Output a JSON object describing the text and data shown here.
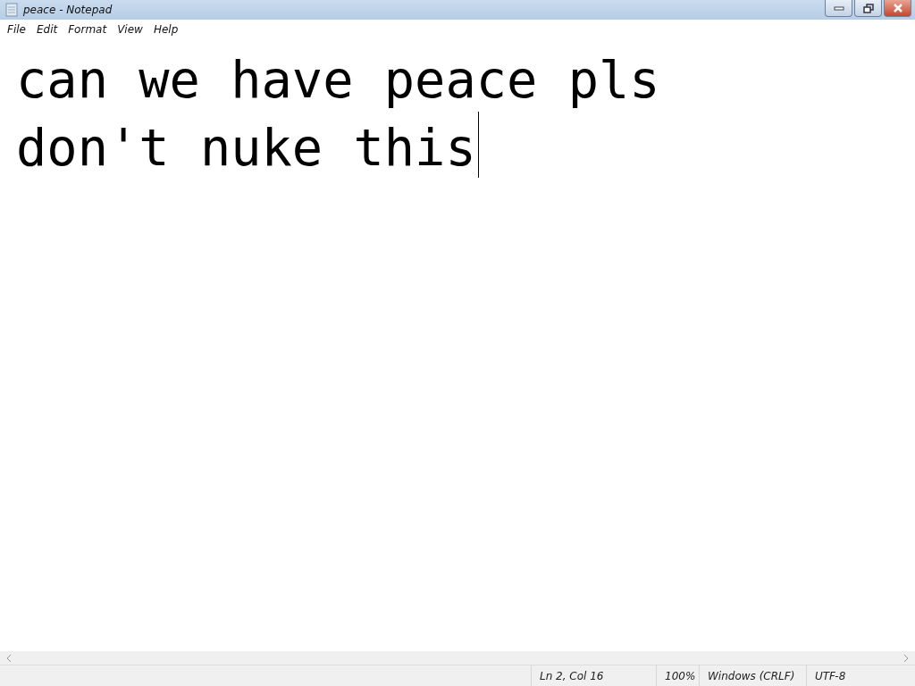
{
  "window": {
    "title": "peace - Notepad"
  },
  "menu": [
    "File",
    "Edit",
    "Format",
    "View",
    "Help"
  ],
  "document": {
    "lines": [
      "can we have peace pls",
      "don't nuke this"
    ]
  },
  "status_bar": [
    "Ln 2, Col 16",
    "100%",
    "Windows (CRLF)",
    "UTF-8"
  ]
}
